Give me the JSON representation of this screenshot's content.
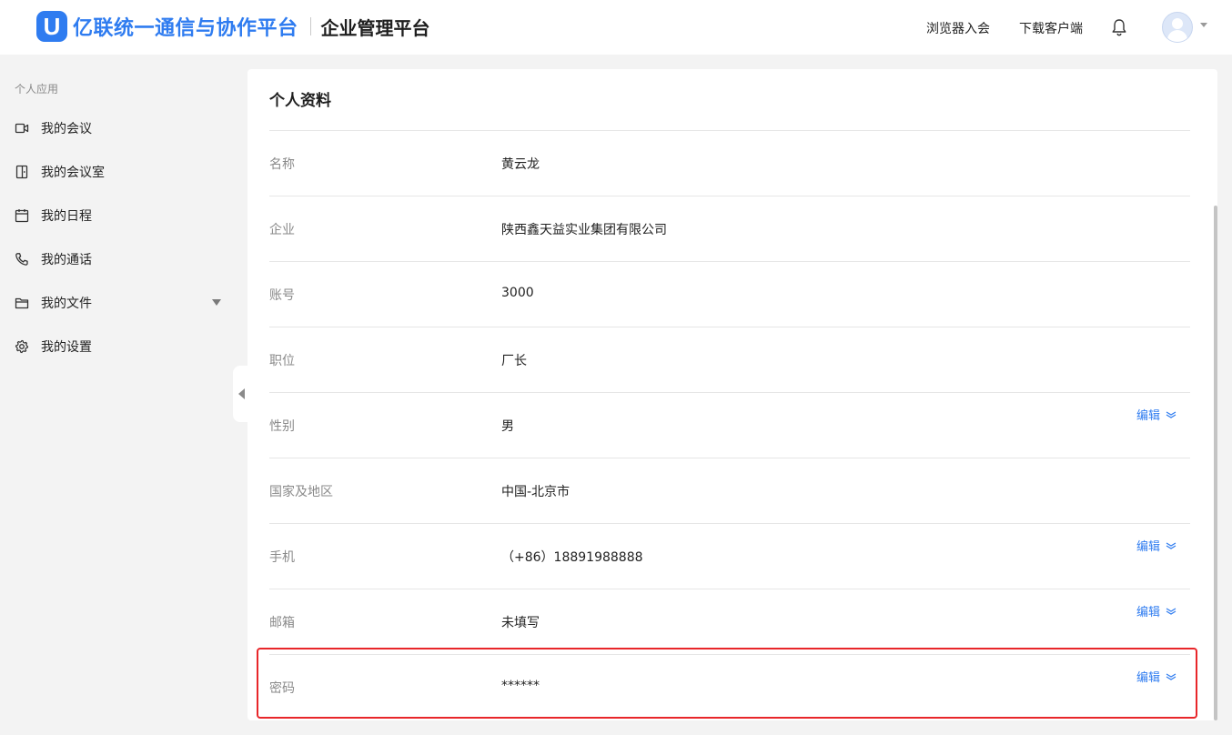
{
  "header": {
    "brand_mark": "U",
    "brand_name": "亿联统一通信与协作平台",
    "platform_name": "企业管理平台",
    "join_via_browser": "浏览器入会",
    "download_client": "下载客户端"
  },
  "sidebar": {
    "section_title": "个人应用",
    "items": [
      {
        "label": "我的会议",
        "icon": "video-camera-icon"
      },
      {
        "label": "我的会议室",
        "icon": "meeting-room-door-icon"
      },
      {
        "label": "我的日程",
        "icon": "calendar-icon"
      },
      {
        "label": "我的通话",
        "icon": "phone-icon"
      },
      {
        "label": "我的文件",
        "icon": "folder-icon"
      },
      {
        "label": "我的设置",
        "icon": "gear-icon"
      }
    ]
  },
  "profile": {
    "title": "个人资料",
    "edit_label": "编辑",
    "rows": [
      {
        "label": "名称",
        "value": "黄云龙"
      },
      {
        "label": "企业",
        "value": "陕西鑫天益实业集团有限公司"
      },
      {
        "label": "账号",
        "value": "3000"
      },
      {
        "label": "职位",
        "value": "厂长"
      },
      {
        "label": "性别",
        "value": "男"
      },
      {
        "label": "国家及地区",
        "value": "中国-北京市"
      },
      {
        "label": "手机",
        "value": "（+86）18891988888"
      },
      {
        "label": "邮箱",
        "value": "未填写"
      },
      {
        "label": "密码",
        "value": "******"
      }
    ]
  },
  "colors": {
    "accent": "#2f7cf0",
    "highlight_border": "#e8262a"
  }
}
